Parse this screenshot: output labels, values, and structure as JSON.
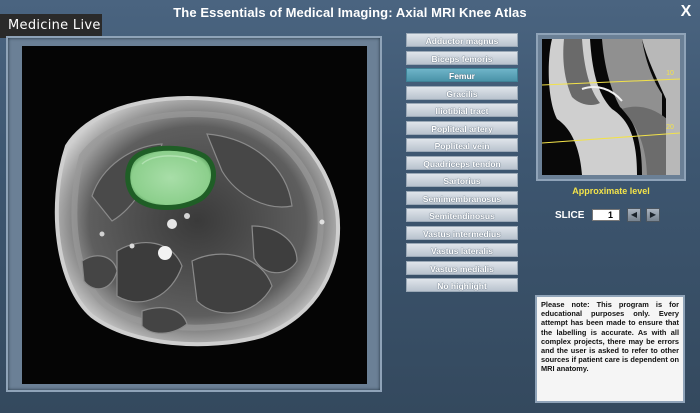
{
  "header": {
    "title": "The Essentials of Medical Imaging: Axial MRI Knee Atlas",
    "close_label": "X",
    "logo_text": "Medicine Live"
  },
  "structures": [
    {
      "label": "Adductor magnus",
      "active": false
    },
    {
      "label": "Biceps femoris",
      "active": false
    },
    {
      "label": "Femur",
      "active": true
    },
    {
      "label": "Gracilis",
      "active": false
    },
    {
      "label": "Iliotibial tract",
      "active": false
    },
    {
      "label": "Popliteal artery",
      "active": false
    },
    {
      "label": "Popliteal vein",
      "active": false
    },
    {
      "label": "Quadriceps tendon",
      "active": false
    },
    {
      "label": "Sartorius",
      "active": false
    },
    {
      "label": "Semimembranosus",
      "active": false
    },
    {
      "label": "Semitendinosus",
      "active": false
    },
    {
      "label": "Vastus intermedius",
      "active": false
    },
    {
      "label": "Vastus lateralis",
      "active": false
    },
    {
      "label": "Vastus medialis",
      "active": false
    },
    {
      "label": "No highlight",
      "active": false
    }
  ],
  "sagittal": {
    "level_top_label": "10",
    "level_bottom_label": "20",
    "caption": "Approximate level"
  },
  "slice": {
    "label": "SLICE",
    "value": "1",
    "prev_icon": "left-arrow-icon",
    "next_icon": "right-arrow-icon"
  },
  "note": "Please note: This program is for educational purposes only. Every attempt has been made to ensure that the labelling is accurate. As with all complex projects, there may be errors and the user is asked to refer to other sources if patient care is dependent on MRI anatomy.",
  "colors": {
    "highlight": "#3f9a4a",
    "active_button": "#4a93a8",
    "caption": "#f2e24a"
  }
}
